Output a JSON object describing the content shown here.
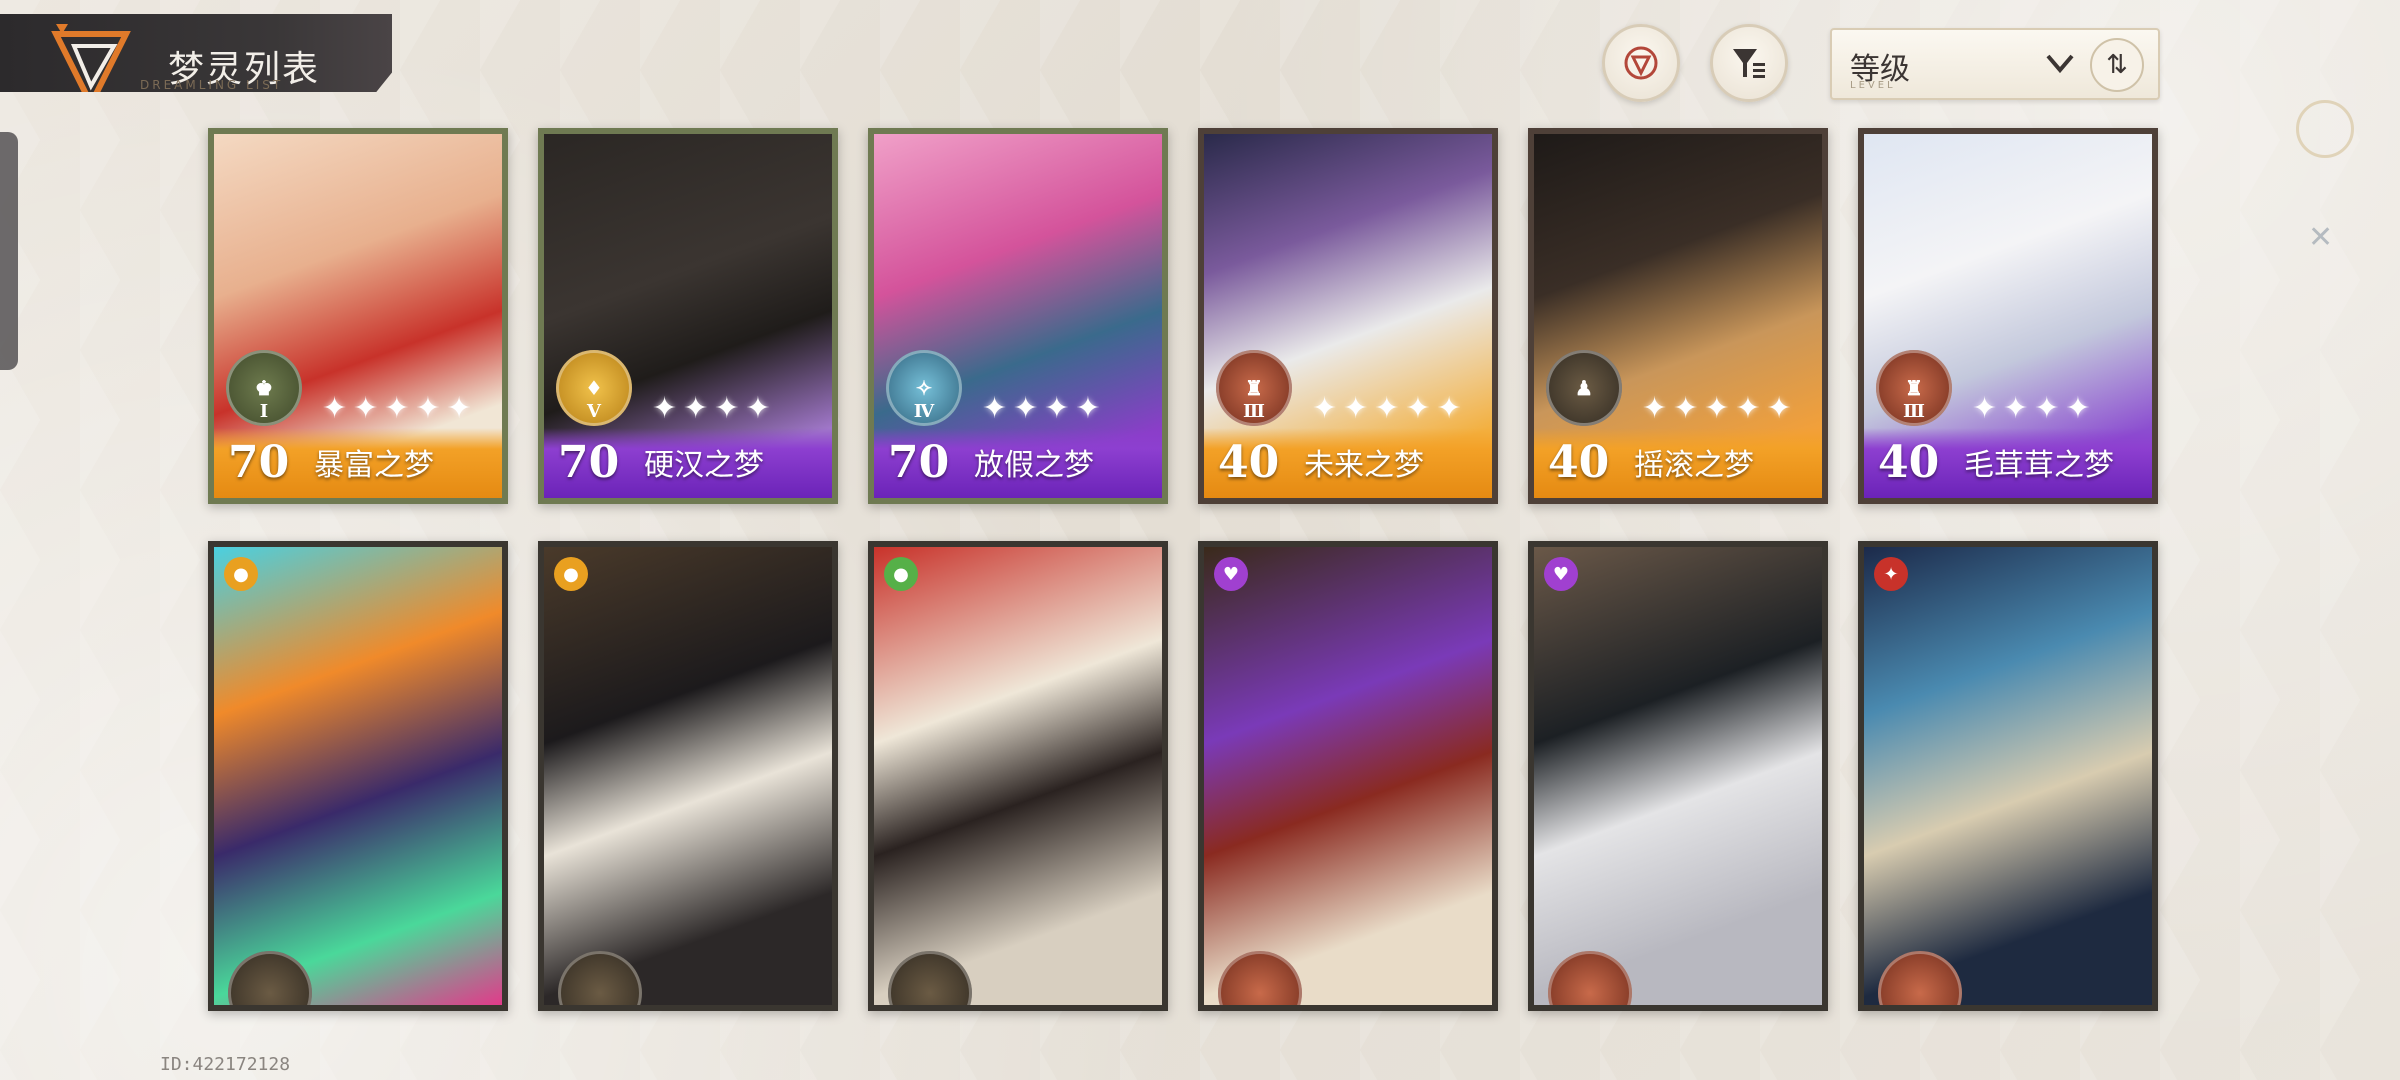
{
  "header": {
    "title": "梦灵列表",
    "subtitle": "DREAMLING LIST"
  },
  "controls": {
    "sort_label": "等级",
    "sort_sub": "LEVEL",
    "order_symbol": "⇅"
  },
  "footer": {
    "id": "ID:422172128"
  },
  "cards_row1": [
    {
      "level": "70",
      "name": "暴富之梦",
      "stars": "✦✦✦✦✦",
      "rank": "Ⅰ",
      "bar": "orange",
      "frame": "green",
      "badge": "green"
    },
    {
      "level": "70",
      "name": "硬汉之梦",
      "stars": "✦✦✦✦",
      "rank": "Ⅴ",
      "bar": "purple",
      "frame": "green",
      "badge": "gold"
    },
    {
      "level": "70",
      "name": "放假之梦",
      "stars": "✦✦✦✦",
      "rank": "Ⅳ",
      "bar": "purple",
      "frame": "green",
      "badge": "blue"
    },
    {
      "level": "40",
      "name": "未来之梦",
      "stars": "✦✦✦✦✦",
      "rank": "Ⅲ",
      "bar": "orange",
      "frame": "bronze",
      "badge": "copper"
    },
    {
      "level": "40",
      "name": "摇滚之梦",
      "stars": "✦✦✦✦✦",
      "rank": "",
      "bar": "orange",
      "frame": "bronze",
      "badge": "dark"
    },
    {
      "level": "40",
      "name": "毛茸茸之梦",
      "stars": "✦✦✦✦",
      "rank": "Ⅲ",
      "bar": "purple",
      "frame": "bronze",
      "badge": "copper"
    }
  ],
  "colors": {
    "orange_bar": "#f3a127",
    "purple_bar": "#8d3fd0",
    "frame_green": "#6f7a52",
    "frame_bronze": "#4e4038"
  }
}
